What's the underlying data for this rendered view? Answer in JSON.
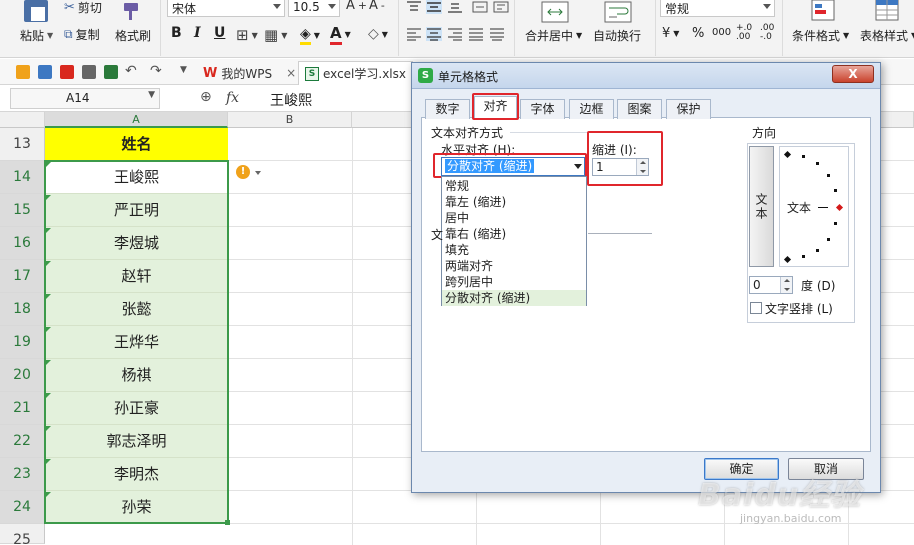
{
  "ribbon": {
    "paste": "粘贴",
    "cut": "剪切",
    "copy": "复制",
    "format_painter": "格式刷",
    "font_name": "宋体",
    "font_size": "10.5",
    "bold": "B",
    "italic": "I",
    "underline": "U",
    "merge_center": "合并居中",
    "wrap_text": "自动换行",
    "number_format": "常规",
    "percent": "%",
    "thousands": "000",
    "cond_format": "条件格式",
    "table_style": "表格样式"
  },
  "tabs": [
    {
      "label": "我的WPS"
    },
    {
      "label": "excel学习.xlsx"
    }
  ],
  "formula_bar": {
    "cell_ref": "A14",
    "fx": "fx",
    "content": "王峻熙"
  },
  "columns": [
    "A",
    "B"
  ],
  "rows": [
    {
      "num": "13",
      "name": "姓名"
    },
    {
      "num": "14",
      "name": "王峻熙"
    },
    {
      "num": "15",
      "name": "严正明"
    },
    {
      "num": "16",
      "name": "李煜城"
    },
    {
      "num": "17",
      "name": "赵轩"
    },
    {
      "num": "18",
      "name": "张懿"
    },
    {
      "num": "19",
      "name": "王烨华"
    },
    {
      "num": "20",
      "name": "杨祺"
    },
    {
      "num": "21",
      "name": "孙正豪"
    },
    {
      "num": "22",
      "name": "郭志泽明"
    },
    {
      "num": "23",
      "name": "李明杰"
    },
    {
      "num": "24",
      "name": "孙荣"
    },
    {
      "num": "25",
      "name": ""
    }
  ],
  "dialog": {
    "title": "单元格格式",
    "close": "X",
    "tabs": [
      "数字",
      "对齐",
      "字体",
      "边框",
      "图案",
      "保护"
    ],
    "active_tab": "对齐",
    "text_align_group": "文本对齐方式",
    "horizontal_label": "水平对齐 (H):",
    "horizontal_value": "分散对齐 (缩进)",
    "indent_label": "缩进 (I):",
    "indent_value": "1",
    "vertical_label_partial": "文",
    "horizontal_options": [
      "常规",
      "靠左 (缩进)",
      "居中",
      "靠右 (缩进)",
      "填充",
      "两端对齐",
      "跨列居中",
      "分散对齐 (缩进)"
    ],
    "orientation_group": "方向",
    "vertical_text": "文本",
    "dial_text": "文本",
    "degree_value": "0",
    "degree_label": "度 (D)",
    "vertical_stack": "文字竖排 (L)",
    "ok": "确定",
    "cancel": "取消"
  },
  "watermark": {
    "main": "Baidu经验",
    "sub": "jingyan.baidu.com"
  }
}
